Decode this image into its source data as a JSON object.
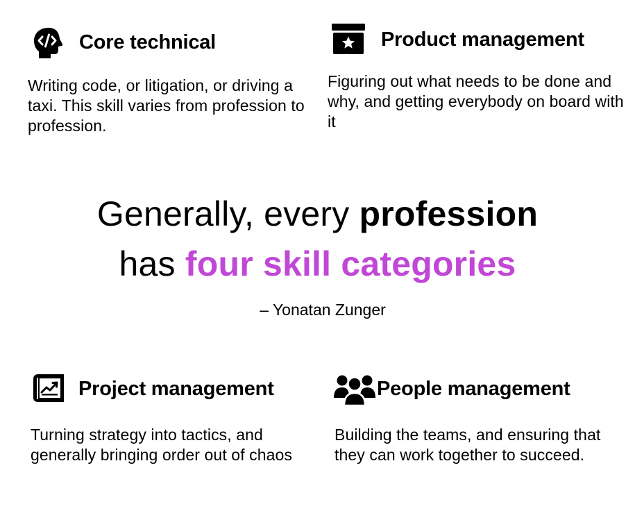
{
  "colors": {
    "text": "#000000",
    "accent": "#c147d6",
    "background": "#ffffff"
  },
  "skills": {
    "core": {
      "icon": "head-code-icon",
      "title": "Core technical",
      "description": "Writing code, or litigation, or driving a taxi. This skill varies from profession to profession."
    },
    "product": {
      "icon": "box-star-icon",
      "title": "Product management",
      "description": "Figuring out what needs to be done and why, and getting everybody on board with it"
    },
    "project": {
      "icon": "chart-board-icon",
      "title": "Project management",
      "description": "Turning strategy into tactics, and generally bringing order out of chaos"
    },
    "people": {
      "icon": "group-people-icon",
      "title": "People management",
      "description": "Building the teams, and ensuring that they can work together to succeed."
    }
  },
  "headline": {
    "line1_prefix": "Generally, every ",
    "line1_bold": "profession",
    "line2_prefix": "has ",
    "line2_accent": "four skill categories"
  },
  "attribution": "– Yonatan Zunger"
}
